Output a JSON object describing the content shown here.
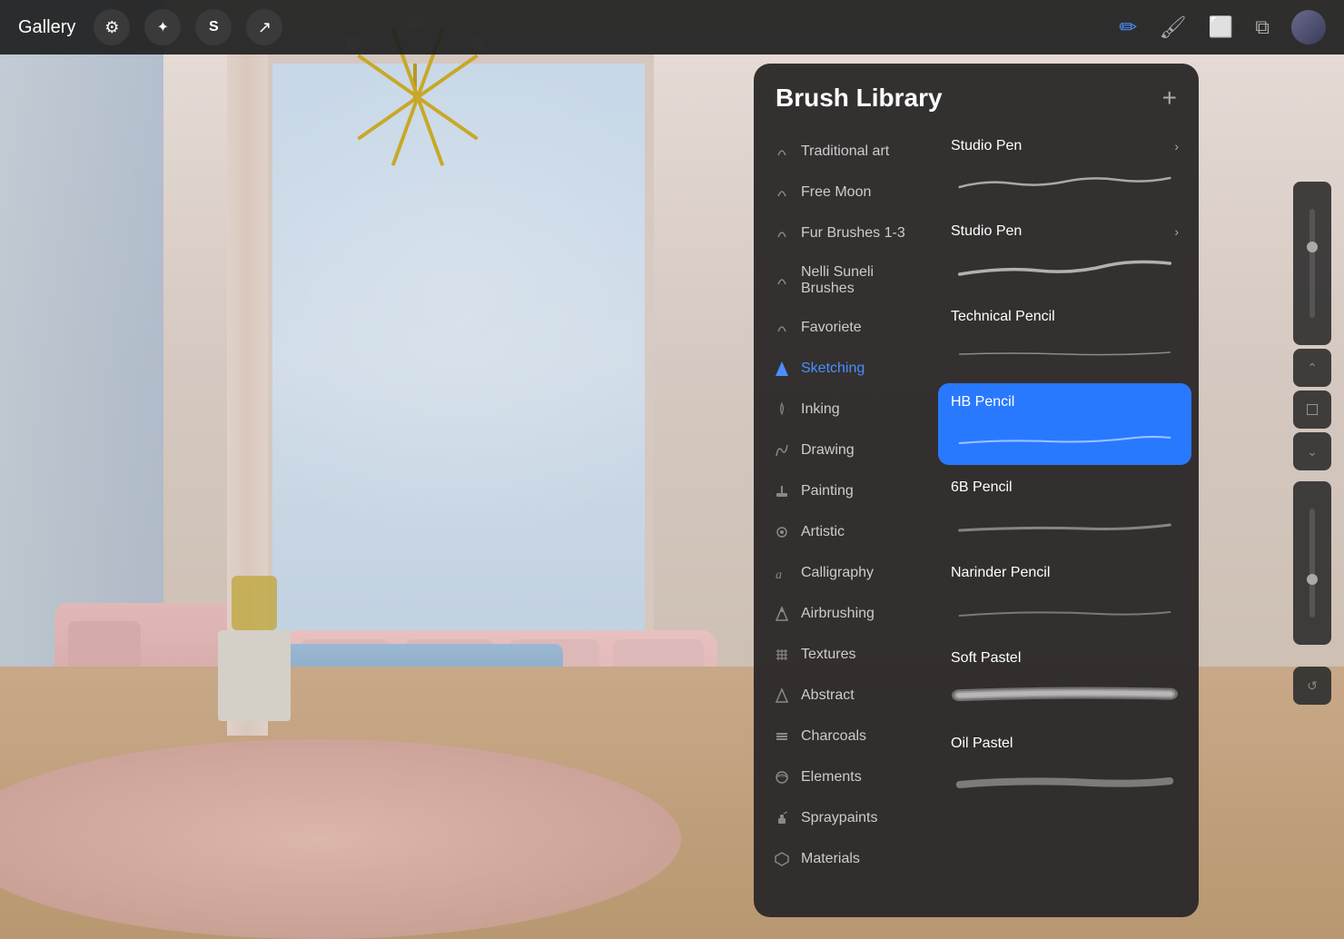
{
  "app": {
    "gallery_label": "Gallery",
    "title": "Brush Library"
  },
  "topbar": {
    "gallery": "Gallery",
    "add_label": "+",
    "icons": [
      {
        "name": "wrench-icon",
        "symbol": "🔧"
      },
      {
        "name": "magic-icon",
        "symbol": "✦"
      },
      {
        "name": "sketch-icon",
        "symbol": "S"
      },
      {
        "name": "arrow-icon",
        "symbol": "↗"
      }
    ],
    "right_icons": [
      {
        "name": "pencil-icon",
        "symbol": "✏",
        "active": true
      },
      {
        "name": "brush-icon",
        "symbol": "🖌"
      },
      {
        "name": "eraser-icon",
        "symbol": "⬜"
      },
      {
        "name": "layers-icon",
        "symbol": "⧉"
      }
    ]
  },
  "brush_library": {
    "title": "Brush Library",
    "add_btn": "+",
    "categories": [
      {
        "id": "traditional-art",
        "label": "Traditional art",
        "icon": "leaf"
      },
      {
        "id": "free-moon",
        "label": "Free Moon",
        "icon": "leaf"
      },
      {
        "id": "fur-brushes",
        "label": "Fur Brushes 1-3",
        "icon": "leaf"
      },
      {
        "id": "nelli-suneli",
        "label": "Nelli Suneli Brushes",
        "icon": "leaf"
      },
      {
        "id": "favoriete",
        "label": "Favoriete",
        "icon": "leaf"
      },
      {
        "id": "sketching",
        "label": "Sketching",
        "icon": "triangle-fill",
        "active": true
      },
      {
        "id": "inking",
        "label": "Inking",
        "icon": "drop"
      },
      {
        "id": "drawing",
        "label": "Drawing",
        "icon": "spiral"
      },
      {
        "id": "painting",
        "label": "Painting",
        "icon": "paint"
      },
      {
        "id": "artistic",
        "label": "Artistic",
        "icon": "circle"
      },
      {
        "id": "calligraphy",
        "label": "Calligraphy",
        "icon": "a"
      },
      {
        "id": "airbrushing",
        "label": "Airbrushing",
        "icon": "triangle"
      },
      {
        "id": "textures",
        "label": "Textures",
        "icon": "hash"
      },
      {
        "id": "abstract",
        "label": "Abstract",
        "icon": "triangle-outline"
      },
      {
        "id": "charcoals",
        "label": "Charcoals",
        "icon": "bars"
      },
      {
        "id": "elements",
        "label": "Elements",
        "icon": "circle-half"
      },
      {
        "id": "spraypaints",
        "label": "Spraypaints",
        "icon": "spray"
      },
      {
        "id": "materials",
        "label": "Materials",
        "icon": "cube"
      }
    ],
    "brushes": [
      {
        "id": "studio-pen-1",
        "name": "Studio Pen",
        "selected": false,
        "chevron": true
      },
      {
        "id": "studio-pen-2",
        "name": "Studio Pen",
        "selected": false,
        "chevron": true
      },
      {
        "id": "technical-pencil",
        "name": "Technical Pencil",
        "selected": false,
        "chevron": false
      },
      {
        "id": "hb-pencil",
        "name": "HB Pencil",
        "selected": true,
        "chevron": false
      },
      {
        "id": "6b-pencil",
        "name": "6B Pencil",
        "selected": false,
        "chevron": false
      },
      {
        "id": "narinder-pencil",
        "name": "Narinder Pencil",
        "selected": false,
        "chevron": false
      },
      {
        "id": "soft-pastel",
        "name": "Soft Pastel",
        "selected": false,
        "chevron": false
      },
      {
        "id": "oil-pastel",
        "name": "Oil Pastel",
        "selected": false,
        "chevron": false
      }
    ]
  }
}
